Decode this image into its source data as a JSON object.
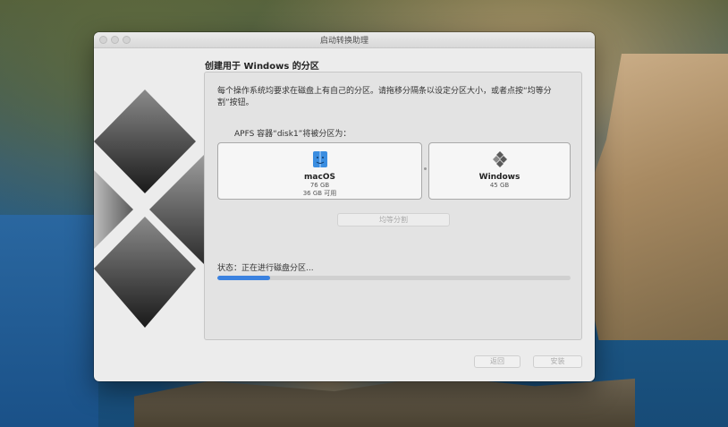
{
  "window": {
    "title": "启动转换助理"
  },
  "page": {
    "heading": "创建用于 Windows 的分区",
    "description": "每个操作系统均要求在磁盘上有自己的分区。请拖移分隔条以设定分区大小，或者点按“均等分割”按钮。",
    "split_label": "APFS 容器“disk1”将被分区为："
  },
  "partitions": [
    {
      "name": "macOS",
      "size": "76 GB",
      "available": "36 GB 可用",
      "icon": "macos-disk-icon"
    },
    {
      "name": "Windows",
      "size": "45 GB",
      "icon": "windows-logo-icon"
    }
  ],
  "even_split_button": "均等分割",
  "status": {
    "text": "状态：正在进行磁盘分区...",
    "progress": 0.15,
    "color": "#3b82e0"
  },
  "footer": {
    "back_button": "返回",
    "install_button": "安装"
  }
}
